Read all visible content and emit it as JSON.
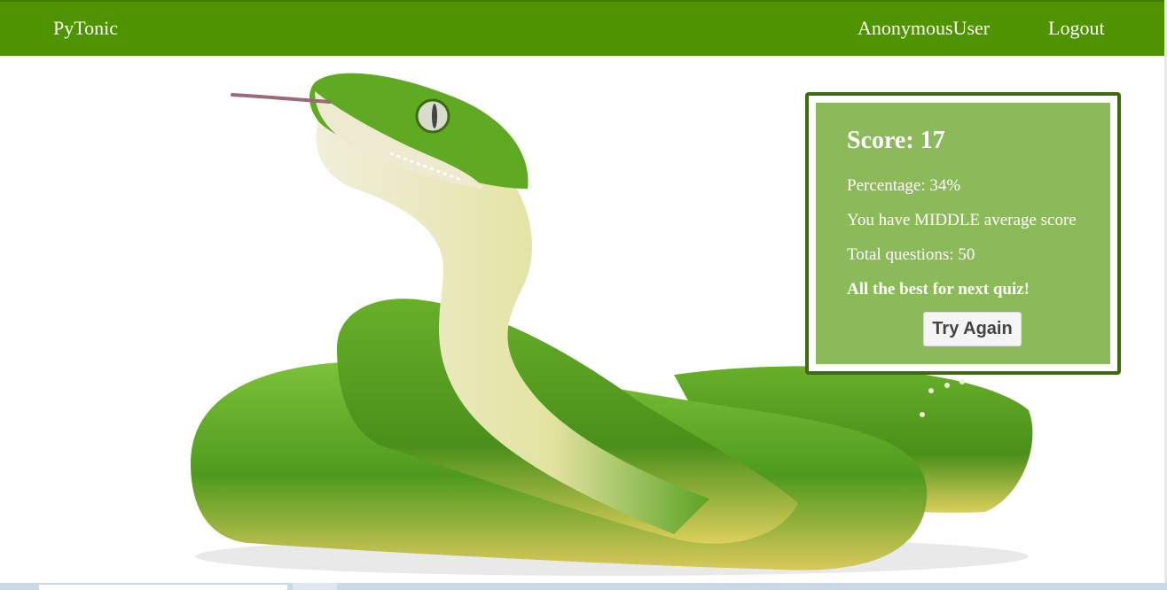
{
  "navbar": {
    "brand": "PyTonic",
    "user": "AnonymousUser",
    "logout": "Logout"
  },
  "hero": {
    "image": "green-tree-python-snake"
  },
  "result": {
    "title": "Score: 17",
    "percentage": "Percentage: 34%",
    "average": "You have MIDDLE average score",
    "total": "Total questions: 50",
    "wish": "All the best for next quiz!",
    "button": "Try Again"
  },
  "colors": {
    "navbar": "#4f9400",
    "card": "#8cb95a",
    "card_border": "#3e6b10"
  }
}
